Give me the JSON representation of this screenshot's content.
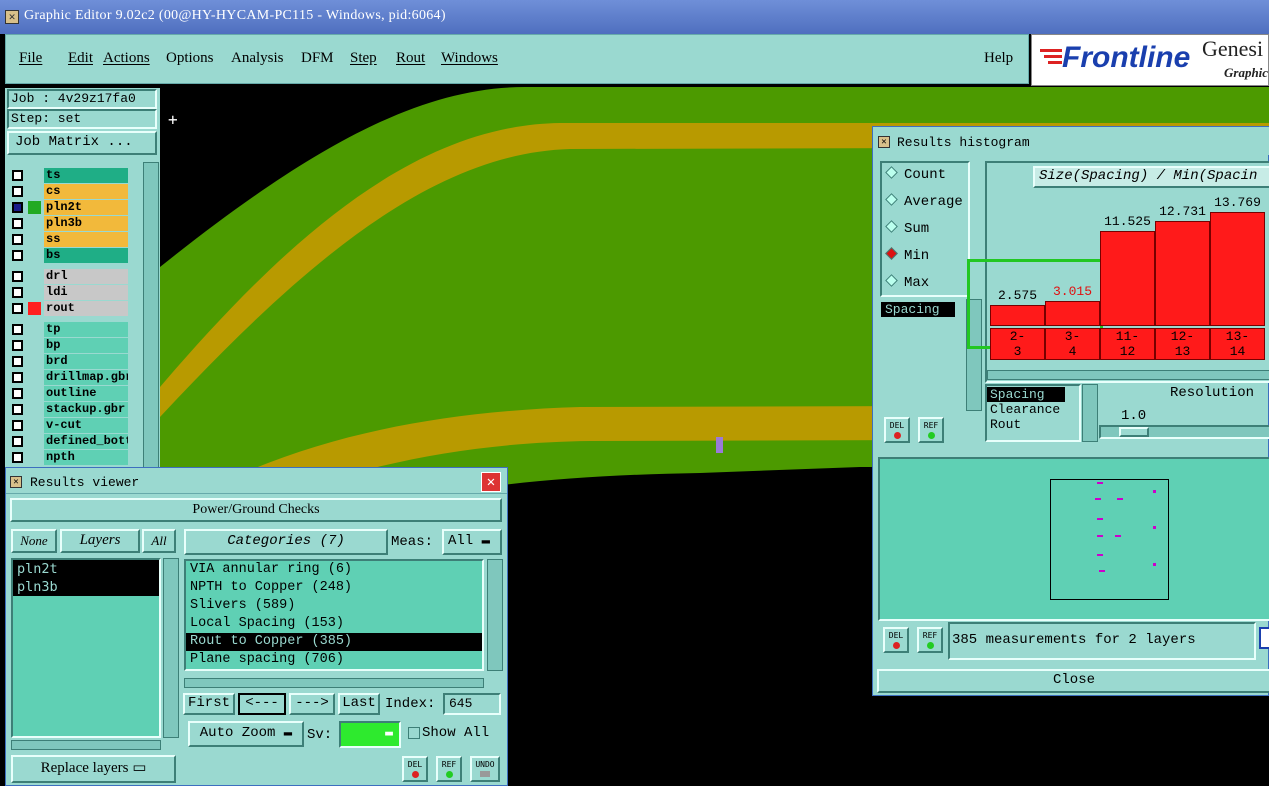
{
  "window": {
    "title": "Graphic Editor 9.02c2 (00@HY-HYCAM-PC115 - Windows, pid:6064)"
  },
  "menu": {
    "items": [
      "File",
      "Edit",
      "Actions",
      "Options",
      "Analysis",
      "DFM",
      "Step",
      "Rout",
      "Windows"
    ],
    "help": "Help"
  },
  "logo": {
    "brand": "Frontline",
    "product": "Genesi",
    "sub": "Graphic"
  },
  "job": {
    "job_label": "Job : 4v29z17fa0",
    "step_label": "Step: set",
    "matrix_button": "Job Matrix ..."
  },
  "layers": [
    {
      "name": "ts",
      "color": "#1fae86",
      "swatch": ""
    },
    {
      "name": "cs",
      "color": "#f2b93b",
      "swatch": ""
    },
    {
      "name": "pln2t",
      "color": "#f2b93b",
      "swatch": "#22aa22"
    },
    {
      "name": "pln3b",
      "color": "#f2b93b",
      "swatch": ""
    },
    {
      "name": "ss",
      "color": "#f2b93b",
      "swatch": ""
    },
    {
      "name": "bs",
      "color": "#1fae86",
      "swatch": ""
    },
    {
      "name": "drl",
      "color": "#c8c8c8",
      "swatch": ""
    },
    {
      "name": "ldi",
      "color": "#c8c8c8",
      "swatch": ""
    },
    {
      "name": "rout",
      "color": "#c8c8c8",
      "swatch": "#ff2020"
    },
    {
      "name": "tp",
      "color": "#5fd0b4",
      "swatch": ""
    },
    {
      "name": "bp",
      "color": "#5fd0b4",
      "swatch": ""
    },
    {
      "name": "brd",
      "color": "#5fd0b4",
      "swatch": ""
    },
    {
      "name": "drillmap.gbr",
      "color": "#5fd0b4",
      "swatch": ""
    },
    {
      "name": "outline",
      "color": "#5fd0b4",
      "swatch": ""
    },
    {
      "name": "stackup.gbr",
      "color": "#5fd0b4",
      "swatch": ""
    },
    {
      "name": "v-cut",
      "color": "#5fd0b4",
      "swatch": ""
    },
    {
      "name": "defined_bott",
      "color": "#5fd0b4",
      "swatch": ""
    },
    {
      "name": "npth",
      "color": "#5fd0b4",
      "swatch": ""
    }
  ],
  "results_viewer": {
    "title": "Results viewer",
    "check_name": "Power/Ground Checks",
    "none_label": "None",
    "layers_label": "Layers",
    "all_label": "All",
    "layer_items": [
      "pln2t",
      "pln3b"
    ],
    "categories_label": "Categories (7)",
    "meas_label": "Meas:",
    "meas_value": "All",
    "categories": [
      "VIA annular ring (6)",
      "NPTH to Copper (248)",
      "Slivers (589)",
      "Local Spacing (153)",
      "Rout to Copper (385)",
      "Plane spacing (706)"
    ],
    "selected_category": "Rout to Copper (385)",
    "nav": {
      "first": "First",
      "prev": "<---",
      "next": "--->",
      "last": "Last",
      "index_label": "Index:",
      "index_value": "645"
    },
    "auto_zoom": "Auto Zoom",
    "sv_label": "Sv:",
    "show_all": "Show All",
    "replace_layers": "Replace layers",
    "icon_del": "DEL",
    "icon_ref": "REF",
    "icon_undo": "UNDO"
  },
  "histogram": {
    "title": "Results histogram",
    "modes": [
      "Count",
      "Average",
      "Sum",
      "Min",
      "Max"
    ],
    "selected_mode": "Min",
    "measure_list": [
      "Spacing"
    ],
    "chart_title": "Size(Spacing) / Min(Spacin",
    "bars": [
      {
        "value": "2.575",
        "label_top": "2-",
        "label_bottom": "3",
        "highlight": false
      },
      {
        "value": "3.015",
        "label_top": "3-",
        "label_bottom": "4",
        "highlight": true
      },
      {
        "value": "11.525",
        "label_top": "11-",
        "label_bottom": "12",
        "highlight": false
      },
      {
        "value": "12.731",
        "label_top": "12-",
        "label_bottom": "13",
        "highlight": false
      },
      {
        "value": "13.769",
        "label_top": "13-",
        "label_bottom": "14",
        "highlight": false
      }
    ],
    "types": [
      "Spacing",
      "Clearance",
      "Rout"
    ],
    "resolution_label": "Resolution",
    "resolution_value": "1.0",
    "status": "385 measurements for 2 layers",
    "close": "Close"
  },
  "colors": {
    "board_green": "#4c9a00",
    "copper": "#b89a00",
    "panel": "#9ad9d0"
  }
}
